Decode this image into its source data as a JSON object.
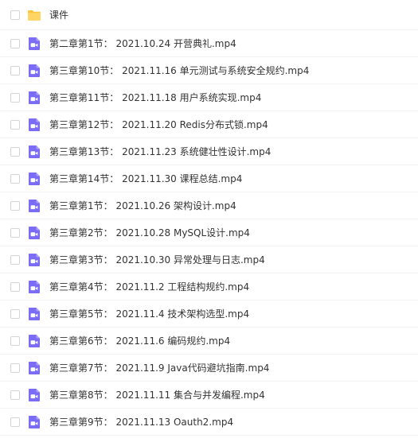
{
  "colors": {
    "folder": "#ffc53d",
    "video_icon_bg": "#7b6cf6",
    "text": "#333333",
    "divider": "#f1f2f4"
  },
  "files": [
    {
      "name": "课件",
      "type": "folder",
      "icon": "folder-icon"
    },
    {
      "name": "第二章第1节： 2021.10.24 开营典礼.mp4",
      "type": "video",
      "icon": "video-file-icon"
    },
    {
      "name": "第三章第10节： 2021.11.16 单元测试与系统安全规约.mp4",
      "type": "video",
      "icon": "video-file-icon"
    },
    {
      "name": "第三章第11节： 2021.11.18 用户系统实现.mp4",
      "type": "video",
      "icon": "video-file-icon"
    },
    {
      "name": "第三章第12节： 2021.11.20 Redis分布式锁.mp4",
      "type": "video",
      "icon": "video-file-icon"
    },
    {
      "name": "第三章第13节： 2021.11.23 系统健壮性设计.mp4",
      "type": "video",
      "icon": "video-file-icon"
    },
    {
      "name": "第三章第14节： 2021.11.30 课程总结.mp4",
      "type": "video",
      "icon": "video-file-icon"
    },
    {
      "name": "第三章第1节： 2021.10.26 架构设计.mp4",
      "type": "video",
      "icon": "video-file-icon"
    },
    {
      "name": "第三章第2节： 2021.10.28 MySQL设计.mp4",
      "type": "video",
      "icon": "video-file-icon"
    },
    {
      "name": "第三章第3节： 2021.10.30 异常处理与日志.mp4",
      "type": "video",
      "icon": "video-file-icon"
    },
    {
      "name": "第三章第4节： 2021.11.2 工程结构规约.mp4",
      "type": "video",
      "icon": "video-file-icon"
    },
    {
      "name": "第三章第5节： 2021.11.4 技术架构选型.mp4",
      "type": "video",
      "icon": "video-file-icon"
    },
    {
      "name": "第三章第6节： 2021.11.6 编码规约.mp4",
      "type": "video",
      "icon": "video-file-icon"
    },
    {
      "name": "第三章第7节： 2021.11.9 Java代码避坑指南.mp4",
      "type": "video",
      "icon": "video-file-icon"
    },
    {
      "name": "第三章第8节： 2021.11.11 集合与并发编程.mp4",
      "type": "video",
      "icon": "video-file-icon"
    },
    {
      "name": "第三章第9节： 2021.11.13 Oauth2.mp4",
      "type": "video",
      "icon": "video-file-icon"
    }
  ]
}
